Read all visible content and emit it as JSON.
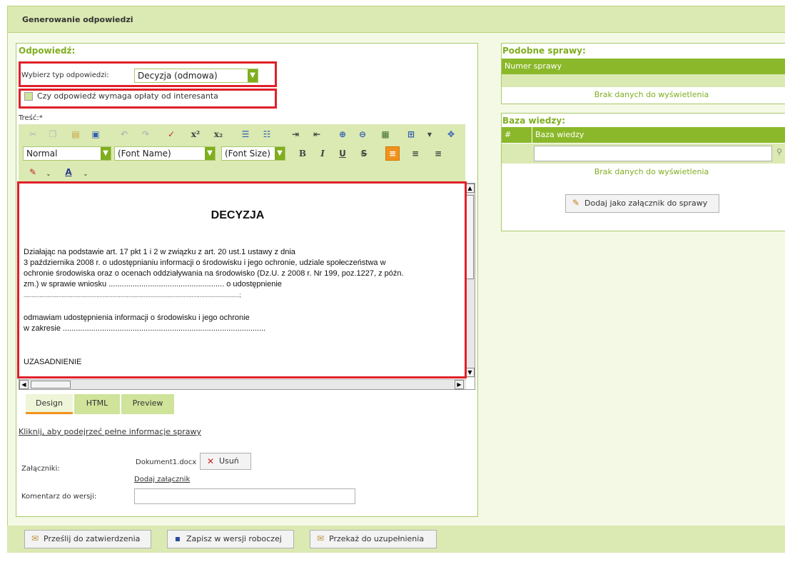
{
  "header": {
    "title": "Generowanie odpowiedzi"
  },
  "response": {
    "section_title": "Odpowiedź:",
    "type_label": "Wybierz typ odpowiedzi:",
    "type_value": "Decyzja (odmowa)",
    "fee_label": "Czy odpowiedź wymaga opłaty od interesanta",
    "content_label": "Treść:*"
  },
  "editor_toolbar": {
    "format_value": "Normal",
    "font_name_value": "(Font Name)",
    "font_size_value": "(Font Size)",
    "bold": "B",
    "italic": "I",
    "underline": "U",
    "strike": "S",
    "superscript": "x²",
    "subscript": "x₂",
    "font_color": "A"
  },
  "document": {
    "heading": "DECYZJA",
    "lines": [
      "Działając na podstawie art. 17 pkt 1 i 2 w związku z art. 20 ust.1 ustawy z dnia",
      "3 października 2008 r. o udostępnianiu informacji o środowisku i jego ochronie, udziale społeczeństwa w",
      "ochronie środowiska oraz o ocenach oddziaływania na środowisko (Dz.U. z 2008 r. Nr 199, poz.1227, z późn.",
      "zm.) w sprawie wniosku ..................................................... o udostępnienie",
      "........................................................................................................................................;",
      "odmawiam udostępnienia informacji o środowisku i jego ochronie",
      "w zakresie .............................................................................................",
      "UZASADNIENIE"
    ]
  },
  "tabs": [
    "Design",
    "HTML",
    "Preview"
  ],
  "case_link": "Kliknij, aby podejrzeć pełne informacje sprawy",
  "attachments": {
    "label": "Załączniki:",
    "file_name": "Dokument1.docx",
    "remove_label": "Usuń",
    "add_link": "Dodaj załącznik"
  },
  "comment": {
    "label": "Komentarz do wersji:",
    "value": ""
  },
  "similar": {
    "title": "Podobne sprawy:",
    "column": "Numer sprawy",
    "empty": "Brak danych do wyświetlenia"
  },
  "knowledge": {
    "title": "Baza wiedzy:",
    "col_hash": "#",
    "col_name": "Baza wiedzy",
    "filter_value": "",
    "empty": "Brak danych do wyświetlenia",
    "add_button": "Dodaj jako załącznik do sprawy"
  },
  "footer_buttons": {
    "send": "Prześlij do zatwierdzenia",
    "save": "Zapisz w wersji roboczej",
    "forward": "Przekaż do uzupełnienia"
  },
  "colors": {
    "accent": "#7fae1f",
    "header_bg": "#dbe9b2",
    "highlight_red": "#e0202a",
    "active_orange": "#f0921e"
  }
}
